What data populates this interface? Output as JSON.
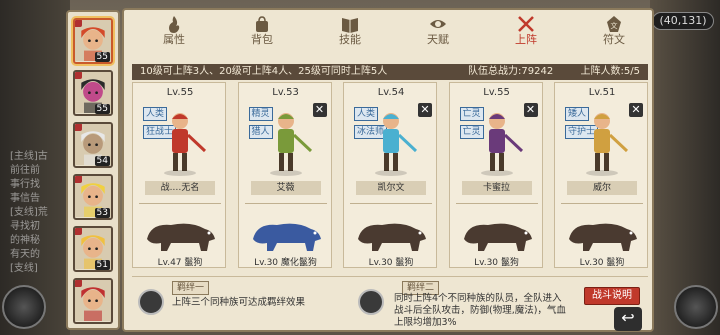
{
  "coord": "(40,131)",
  "left_log": [
    "[主线]古",
    "前往前",
    "事行找",
    "事信告",
    "[支线]荒",
    "寻找初",
    "的神秘",
    "有天的",
    "[支线]"
  ],
  "sidebar": {
    "heroes": [
      {
        "level": "55",
        "hair": "#d44a2a",
        "skin": "#e8b48a",
        "selected": true
      },
      {
        "level": "55",
        "hair": "#2a2a2a",
        "skin": "#c04a8a",
        "selected": false
      },
      {
        "level": "54",
        "hair": "#e8e8e8",
        "skin": "#b89a7a",
        "selected": false
      },
      {
        "level": "53",
        "hair": "#f0d040",
        "skin": "#e8b48a",
        "selected": false
      },
      {
        "level": "51",
        "hair": "#f0c040",
        "skin": "#e8b48a",
        "selected": false
      },
      {
        "level": "",
        "hair": "#c03030",
        "skin": "#e8b48a",
        "selected": false
      }
    ]
  },
  "tabs": [
    {
      "label": "属性",
      "icon": "flame-icon"
    },
    {
      "label": "背包",
      "icon": "bag-icon"
    },
    {
      "label": "技能",
      "icon": "book-icon"
    },
    {
      "label": "天赋",
      "icon": "eye-icon"
    },
    {
      "label": "上阵",
      "icon": "crossed-swords-icon"
    },
    {
      "label": "符文",
      "icon": "rune-icon"
    }
  ],
  "active_tab": 4,
  "info": {
    "rule": "10级可上阵3人、20级可上阵4人、25级可同时上阵5人",
    "power_label": "队伍总战力:",
    "power": "79242",
    "count_label": "上阵人数:",
    "count": "5/5"
  },
  "cards": [
    {
      "level": "Lv.55",
      "race": "人类",
      "job": "狂战士",
      "name": "战.…无名",
      "pet_level": "Lv.47",
      "pet_name": "鬣狗",
      "closable": false,
      "accent": "#c0392b"
    },
    {
      "level": "Lv.53",
      "race": "精灵",
      "job": "猎人",
      "name": "艾薇",
      "pet_level": "Lv.30",
      "pet_name": "魔化鬣狗",
      "closable": true,
      "accent": "#7a9a3a"
    },
    {
      "level": "Lv.54",
      "race": "人类",
      "job": "冰法师",
      "name": "凯尔文",
      "pet_level": "Lv.30",
      "pet_name": "鬣狗",
      "closable": true,
      "accent": "#4ab0d0"
    },
    {
      "level": "Lv.55",
      "race": "亡灵",
      "job": "亡灵",
      "name": "卡蜜拉",
      "pet_level": "Lv.30",
      "pet_name": "鬣狗",
      "closable": true,
      "accent": "#6a3a7a"
    },
    {
      "level": "Lv.51",
      "race": "矮人",
      "job": "守护士",
      "name": "威尔",
      "pet_level": "Lv.30",
      "pet_name": "鬣狗",
      "closable": true,
      "accent": "#d0a040"
    }
  ],
  "bonds": [
    {
      "title": "羁绊一",
      "text": "上阵三个同种族可达成羁绊效果"
    },
    {
      "title": "羁绊二",
      "text": "同时上阵4个不同种族的队员，全队进入战斗后全队攻击，防御(物理,魔法)，气血上限均增加3%"
    }
  ],
  "fight_button": "战斗说明"
}
